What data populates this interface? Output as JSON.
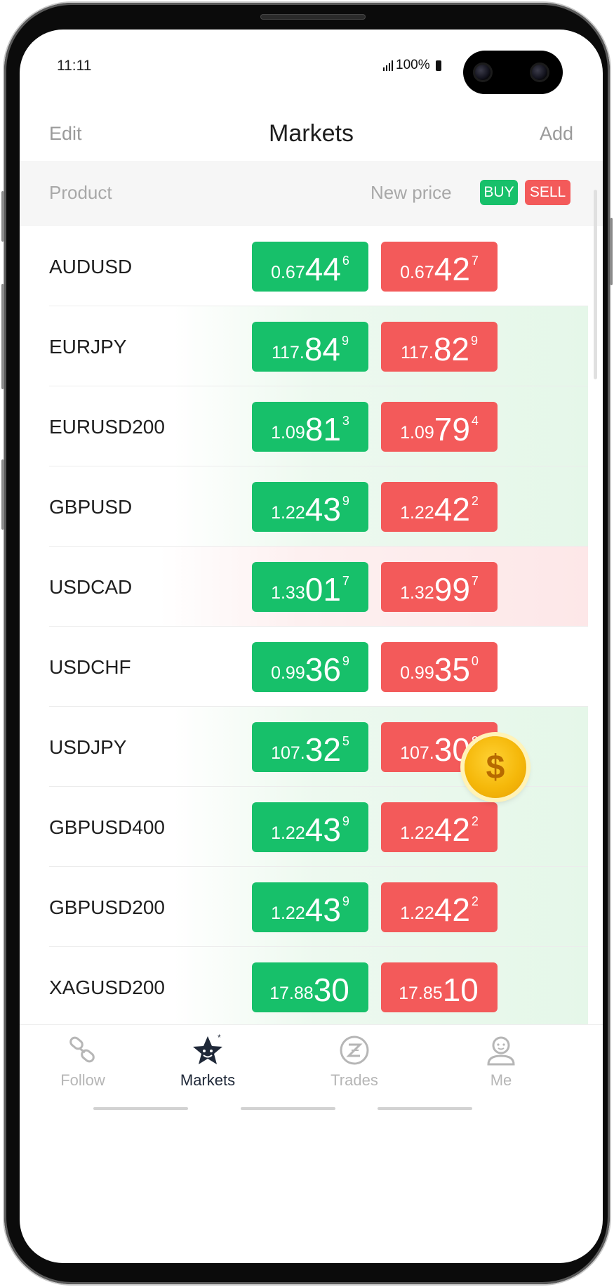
{
  "status_bar": {
    "time": "11:11",
    "battery": "100%"
  },
  "header": {
    "edit": "Edit",
    "title": "Markets",
    "add": "Add"
  },
  "table_header": {
    "product": "Product",
    "new_price": "New price",
    "buy": "BUY",
    "sell": "SELL"
  },
  "rows": [
    {
      "name": "AUDUSD",
      "trend": "none",
      "buy": {
        "small": "0.67",
        "big": "44",
        "sup": "6"
      },
      "sell": {
        "small": "0.67",
        "big": "42",
        "sup": "7"
      }
    },
    {
      "name": "EURJPY",
      "trend": "up",
      "buy": {
        "small": "117.",
        "big": "84",
        "sup": "9"
      },
      "sell": {
        "small": "117.",
        "big": "82",
        "sup": "9"
      }
    },
    {
      "name": "EURUSD200",
      "trend": "up",
      "buy": {
        "small": "1.09",
        "big": "81",
        "sup": "3"
      },
      "sell": {
        "small": "1.09",
        "big": "79",
        "sup": "4"
      }
    },
    {
      "name": "GBPUSD",
      "trend": "up",
      "buy": {
        "small": "1.22",
        "big": "43",
        "sup": "9"
      },
      "sell": {
        "small": "1.22",
        "big": "42",
        "sup": "2"
      }
    },
    {
      "name": "USDCAD",
      "trend": "down",
      "buy": {
        "small": "1.33",
        "big": "01",
        "sup": "7"
      },
      "sell": {
        "small": "1.32",
        "big": "99",
        "sup": "7"
      }
    },
    {
      "name": "USDCHF",
      "trend": "none",
      "buy": {
        "small": "0.99",
        "big": "36",
        "sup": "9"
      },
      "sell": {
        "small": "0.99",
        "big": "35",
        "sup": "0"
      }
    },
    {
      "name": "USDJPY",
      "trend": "up",
      "buy": {
        "small": "107.",
        "big": "32",
        "sup": "5"
      },
      "sell": {
        "small": "107.",
        "big": "30",
        "sup": "8"
      }
    },
    {
      "name": "GBPUSD400",
      "trend": "up",
      "buy": {
        "small": "1.22",
        "big": "43",
        "sup": "9"
      },
      "sell": {
        "small": "1.22",
        "big": "42",
        "sup": "2"
      }
    },
    {
      "name": "GBPUSD200",
      "trend": "up",
      "buy": {
        "small": "1.22",
        "big": "43",
        "sup": "9"
      },
      "sell": {
        "small": "1.22",
        "big": "42",
        "sup": "2"
      }
    },
    {
      "name": "XAGUSD200",
      "trend": "up",
      "buy": {
        "small": "17.88",
        "big": "30",
        "sup": ""
      },
      "sell": {
        "small": "17.85",
        "big": "10",
        "sup": ""
      }
    }
  ],
  "coin": {
    "symbol": "$"
  },
  "tabs": [
    {
      "label": "Follow",
      "icon": "link-icon",
      "active": false
    },
    {
      "label": "Markets",
      "icon": "star-face-icon",
      "active": true
    },
    {
      "label": "Trades",
      "icon": "z-circle-icon",
      "active": false
    },
    {
      "label": "Me",
      "icon": "person-icon",
      "active": false
    }
  ],
  "colors": {
    "buy": "#17c06a",
    "sell": "#f35a5a",
    "up_row_tint": "#e5f7e9",
    "down_row_tint": "#fde7e8",
    "active_tab": "#1f2838",
    "inactive_tab": "#b6b6b6"
  }
}
